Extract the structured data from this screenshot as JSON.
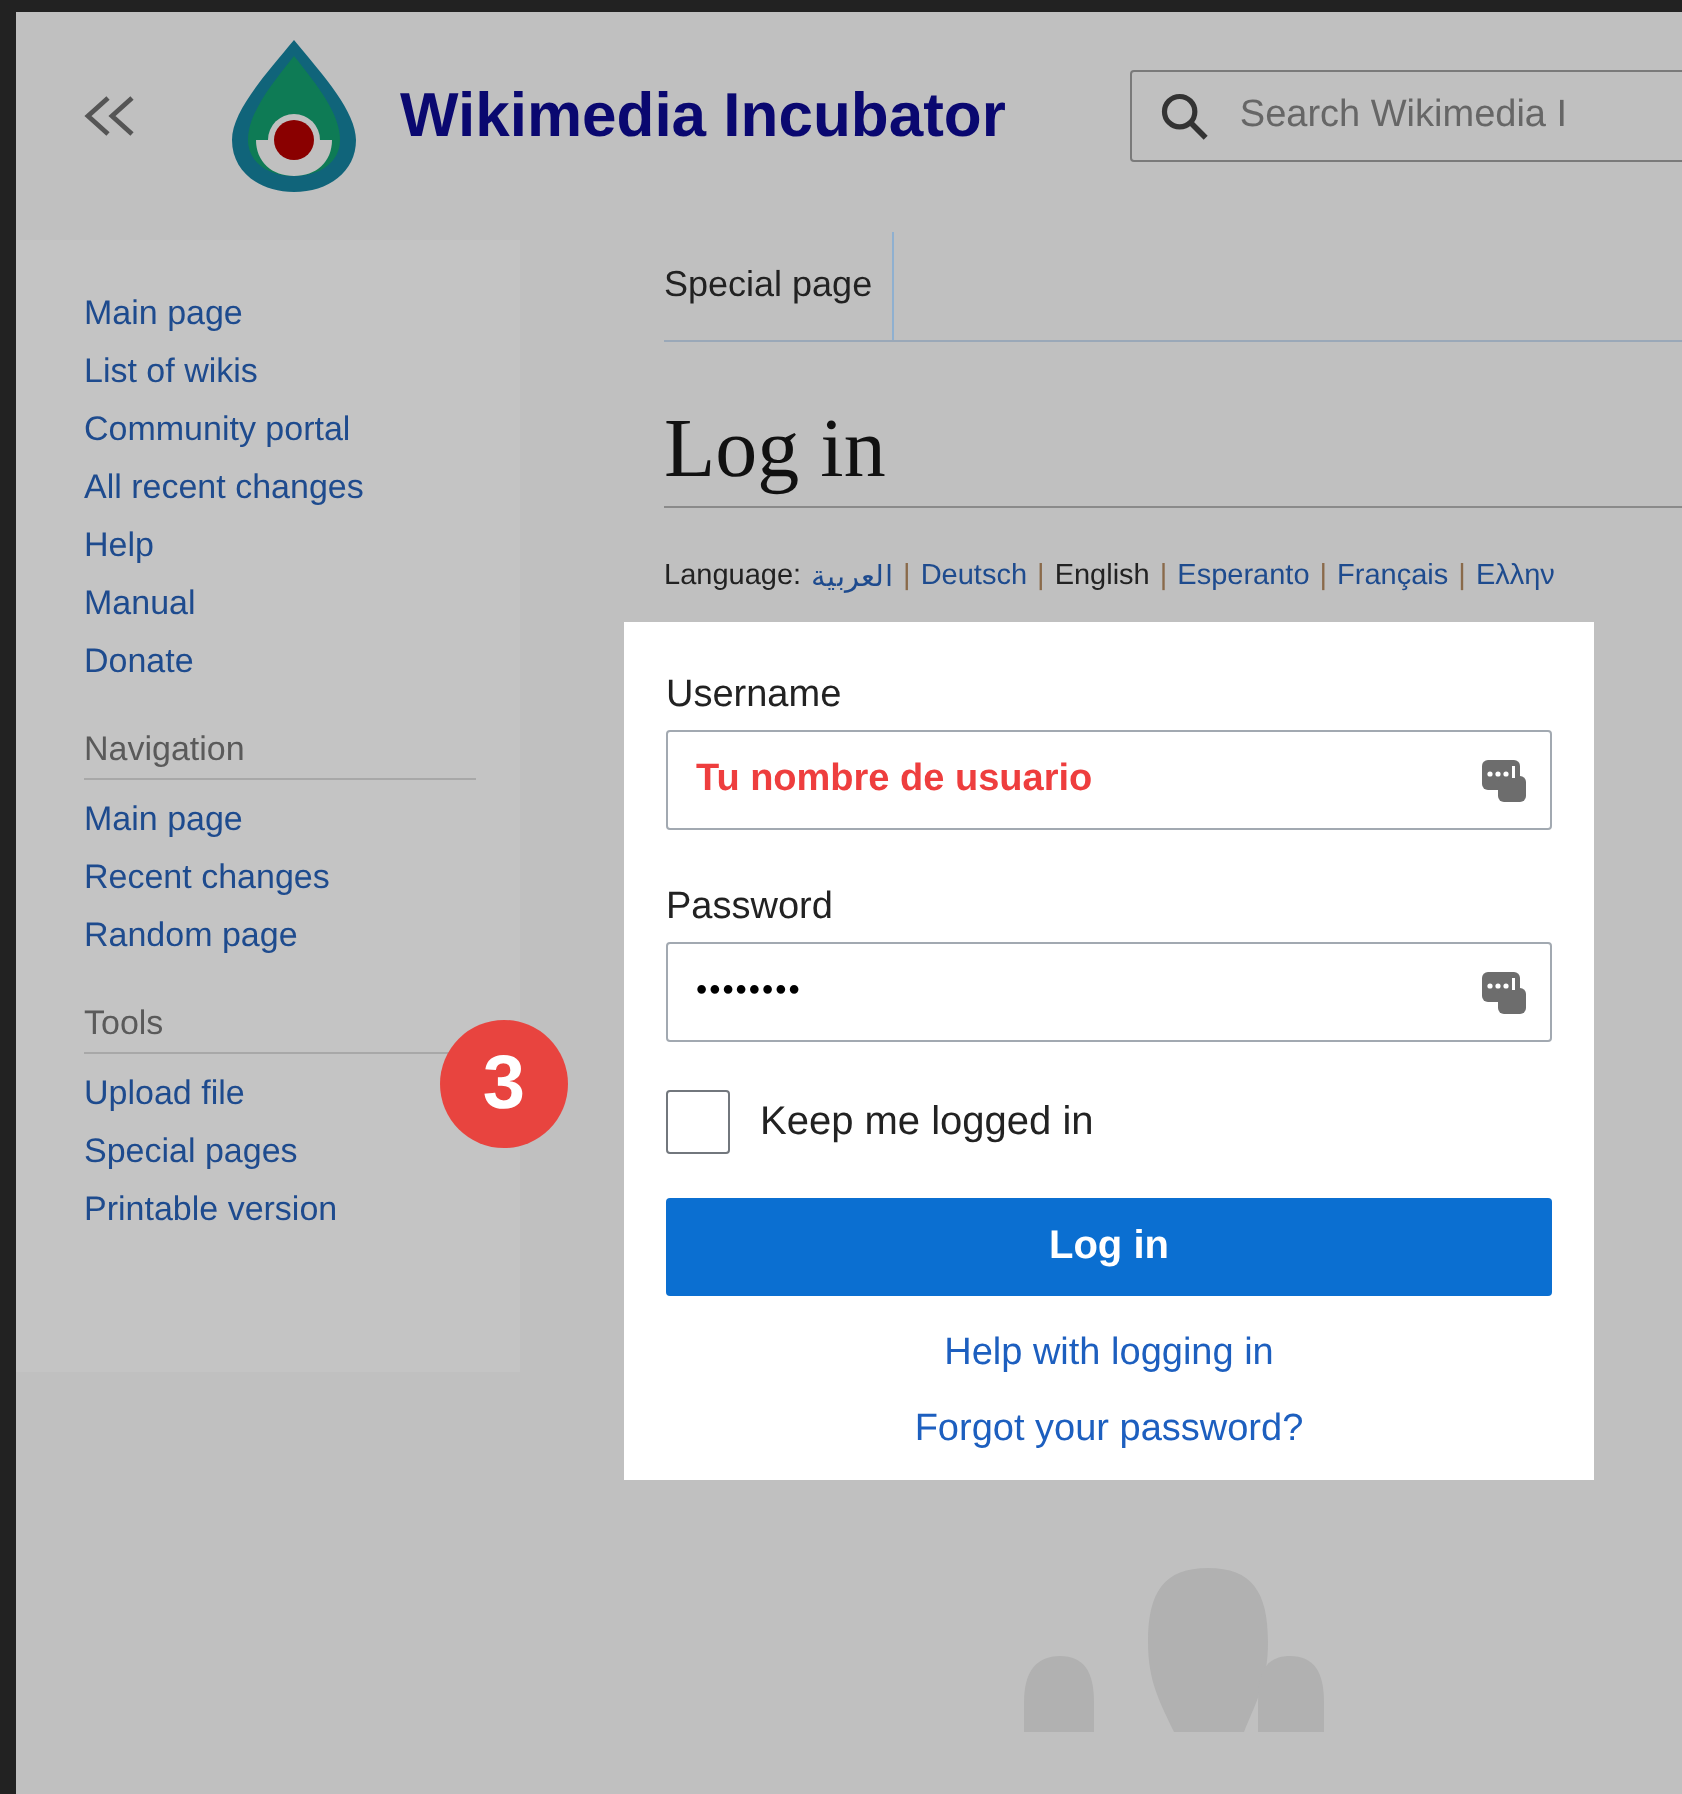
{
  "header": {
    "site_title": "Wikimedia Incubator",
    "search": {
      "placeholder": "Search Wikimedia I"
    }
  },
  "sidebar": {
    "sections": [
      {
        "items": [
          "Main page",
          "List of wikis",
          "Community portal",
          "All recent changes",
          "Help",
          "Manual",
          "Donate"
        ]
      },
      {
        "heading": "Navigation",
        "items": [
          "Main page",
          "Recent changes",
          "Random page"
        ]
      },
      {
        "heading": "Tools",
        "items": [
          "Upload file",
          "Special pages",
          "Printable version"
        ]
      }
    ]
  },
  "tabs": [
    {
      "label": "Special page",
      "selected": true
    }
  ],
  "heading": "Log in",
  "language": {
    "label": "Language:",
    "separator": "|",
    "items": [
      {
        "label": "العربية",
        "selected": false
      },
      {
        "label": "Deutsch",
        "selected": false
      },
      {
        "label": "English",
        "selected": true
      },
      {
        "label": "Esperanto",
        "selected": false
      },
      {
        "label": "Français",
        "selected": false
      },
      {
        "label": "Ελλην",
        "selected": false
      }
    ]
  },
  "form": {
    "fields": [
      {
        "label": "Username",
        "value": "Tu nombre de usuario",
        "kind": "text"
      },
      {
        "label": "Password",
        "value": "••••••••",
        "kind": "password"
      }
    ],
    "remember": {
      "label": "Keep me logged in",
      "checked": false
    },
    "submit": "Log in",
    "links": [
      "Help with logging in",
      "Forgot your password?"
    ]
  },
  "step_badge": "3"
}
